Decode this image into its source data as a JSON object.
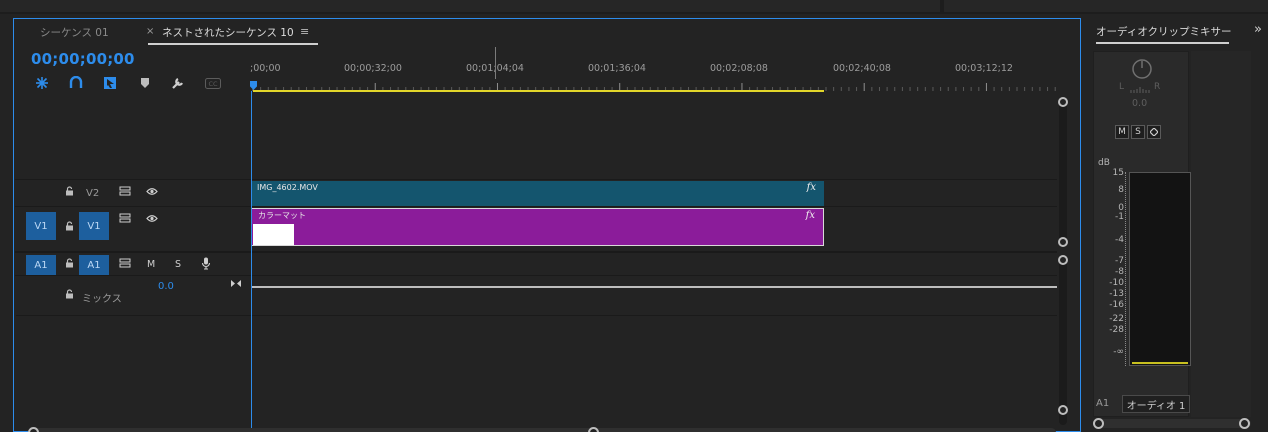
{
  "tabs": {
    "sequence_01": "シーケンス 01",
    "close_glyph": "×",
    "nested_sequence": "ネストされたシーケンス 10",
    "menu_glyph": "≡"
  },
  "timecode": "00;00;00;00",
  "tools": [
    "snap-icon",
    "linked-selection-icon",
    "add-marker-icon",
    "marker-icon",
    "wrench-icon",
    "captions-icon"
  ],
  "ruler": {
    "labels": [
      ";00;00",
      "00;00;32;00",
      "00;01;04;04",
      "00;01;36;04",
      "00;02;08;08",
      "00;02;40;08",
      "00;03;12;12"
    ]
  },
  "tracks": {
    "v2": {
      "name": "V2"
    },
    "v1": {
      "target": "V1",
      "name": "V1"
    },
    "a1": {
      "target": "A1",
      "name": "A1",
      "mute": "M",
      "solo": "S"
    },
    "mix": {
      "name": "ミックス",
      "value": "0.0"
    }
  },
  "clips": {
    "v2_clip": {
      "name": "IMG_4602.MOV",
      "fx": "fx"
    },
    "v1_clip": {
      "name": "カラーマット",
      "fx": "fx"
    }
  },
  "mixer": {
    "title": "オーディオクリップミキサー",
    "more_glyph": "»",
    "pan_l": "L",
    "pan_r": "R",
    "pan_value": "0.0",
    "mute": "M",
    "solo": "S",
    "db_unit": "dB",
    "db_scale": [
      "15",
      "8",
      "0",
      "-1",
      "-4",
      "-7",
      "-8",
      "-10",
      "-13",
      "-16",
      "-22",
      "-28",
      "-∞"
    ],
    "track_label": "A1",
    "output": "オーディオ 1"
  },
  "colors": {
    "accent": "#2d8ceb",
    "v2_clip": "#14556e",
    "v1_clip": "#8b1c9a",
    "inout_bar": "#e2d62a"
  }
}
